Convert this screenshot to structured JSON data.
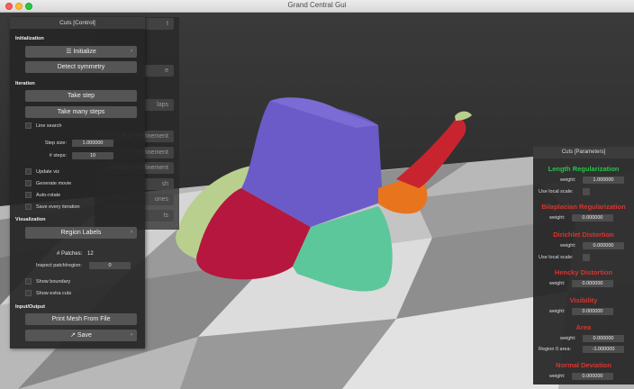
{
  "window": {
    "title": "Grand Central Gui"
  },
  "background_panel": {
    "partial_labels": [
      "t",
      "e",
      "laps",
      "Rule Refinement",
      "Refinement",
      "Adaptive Refinement",
      "sh",
      "ones",
      "ts"
    ]
  },
  "control_panel": {
    "title": "Cuts [Control]",
    "initialization": {
      "header": "Initialization",
      "initialize_label": "Initialize",
      "detect_symmetry_label": "Detect symmetry"
    },
    "iteration": {
      "header": "Iteration",
      "take_step_label": "Take step",
      "take_many_steps_label": "Take many steps",
      "line_search_label": "Line search",
      "step_size_label": "Step size:",
      "step_size_value": "1.000000",
      "steps_label": "# steps:",
      "steps_value": "10",
      "update_viz_label": "Update viz",
      "generate_movie_label": "Generate movie",
      "auto_rotate_label": "Auto-rotate",
      "save_every_iteration_label": "Save every iteration"
    },
    "visualization": {
      "header": "Visualization",
      "region_labels_label": "Region Labels",
      "patches_text": "# Patches:",
      "patches_value": "12",
      "inspect_label": "Inspect patch/region:",
      "inspect_value": "0",
      "show_boundary_label": "Show boundary",
      "show_extra_cuts_label": "Show extra cuts"
    },
    "io": {
      "header": "Input/Output",
      "print_mesh_label": "Print Mesh From File",
      "save_label": "Save"
    }
  },
  "params_panel": {
    "title": "Cuts [Parameters]",
    "length_regularization": {
      "header": "Length Regularization",
      "weight_label": "weight:",
      "weight_value": "1.000000",
      "local_scale_label": "Use local scale:"
    },
    "bilaplacian_regularization": {
      "header": "Bilaplacian Regularization",
      "weight_label": "weight:",
      "weight_value": "0.000000"
    },
    "dirichlet_distortion": {
      "header": "Dirichlet Distortion",
      "weight_label": "weight:",
      "weight_value": "0.000000",
      "local_scale_label": "Use local scale:"
    },
    "hencky_distortion": {
      "header": "Hencky Distortion",
      "weight_label": "weight:",
      "weight_value": "0.000000"
    },
    "visibility": {
      "header": "Visibility",
      "weight_label": "weight:",
      "weight_value": "0.000000"
    },
    "area": {
      "header": "Area",
      "weight_label": "weight:",
      "weight_value": "0.000000",
      "region_area_label": "Region 0 area:",
      "region_area_value": "-1.000000"
    },
    "normal_deviation": {
      "header": "Normal Deviation",
      "weight_label": "weight:",
      "weight_value": "0.000000"
    }
  },
  "colors": {
    "header_green": "#26c64a",
    "header_red": "#d83530",
    "region_purple": "#6a5bc8",
    "region_crimson": "#b5173f",
    "region_teal": "#5cc79a",
    "region_sage": "#b9cf8e",
    "region_orange": "#e8741e",
    "region_red": "#c8242f"
  }
}
